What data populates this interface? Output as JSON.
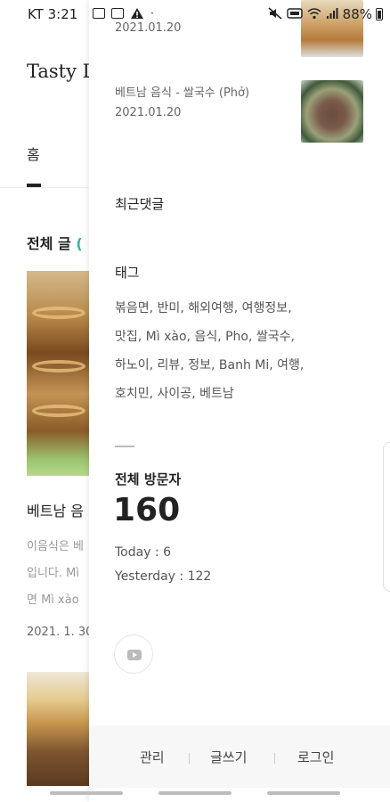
{
  "status_bar": {
    "time": "KT 3:21",
    "battery": "88%"
  },
  "blog": {
    "title": "Tasty L",
    "nav_home": "홈",
    "section_title": "전체 글",
    "section_count": "(",
    "post1": {
      "title": "베트남 음",
      "excerpt_lines": [
        "이음식은 베",
        "입니다. Mì",
        "면 Mì xào "
      ],
      "date": "2021. 1. 30"
    }
  },
  "drawer": {
    "recent_posts": [
      {
        "date": "2021.01.20"
      },
      {
        "title": "베트남 음식 - 쌀국수 (Phở)",
        "date": "2021.01.20"
      }
    ],
    "recent_comments_heading": "최근댓글",
    "tags_heading": "태그",
    "tags": [
      "볶음면",
      "반미",
      "해외여행",
      "여행정보",
      "맛집",
      "Mì xào",
      "음식",
      "Pho",
      "쌀국수",
      "하노이",
      "리뷰",
      "정보",
      "Banh Mi",
      "여행",
      "호치민",
      "사이공",
      "베트남"
    ],
    "visitors": {
      "heading": "전체 방문자",
      "total": "160",
      "today": "Today : 6",
      "yesterday": "Yesterday : 122"
    },
    "footer": {
      "manage": "관리",
      "write": "글쓰기",
      "login": "로그인"
    }
  },
  "icons": [
    "image-icon",
    "screenshot-icon",
    "warning-icon",
    "mute-icon",
    "volte-icon",
    "wifi-icon",
    "signal-icon",
    "battery-icon",
    "youtube-icon"
  ]
}
